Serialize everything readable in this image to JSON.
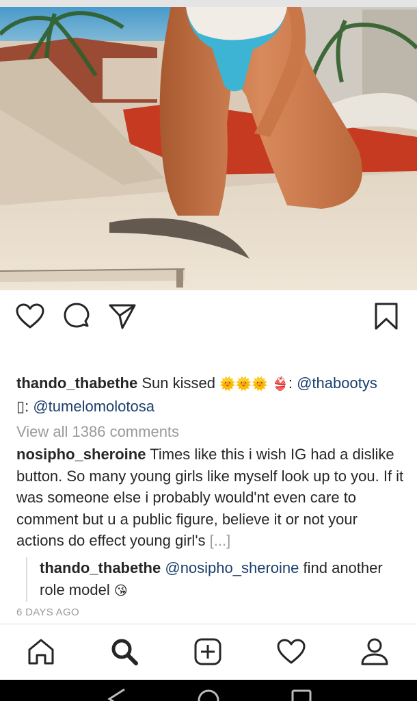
{
  "post": {
    "image_alt": "post photo",
    "actions": {
      "like_icon": "heart-outline-icon",
      "comment_icon": "comment-bubble-icon",
      "share_icon": "paper-plane-icon",
      "save_icon": "bookmark-icon"
    },
    "caption": {
      "username": "thando_thabethe",
      "text": " Sun kissed ",
      "sun_emojis": "🌞🌞🌞",
      "bikini_emoji": "👙",
      "separator": ": ",
      "mention_1": "@thabootys",
      "glyph": "▯",
      "separator_2": ": ",
      "mention_2": "@tumelomolotosa"
    },
    "view_all_comments": "View all 1386 comments",
    "comment": {
      "username": "nosipho_sheroine",
      "text": " Times like this i wish IG had a dislike button. So many young girls like myself look up to you. If it was someone else i probably would'nt even care to comment  but u a  public figure, believe it or not your actions do effect young girl's ",
      "more_label": "[...]"
    },
    "reply": {
      "username": "thando_thabethe",
      "mention": "@nosipho_sheroine",
      "text": " find another role model ",
      "emoji": "😘"
    },
    "timestamp": "6 DAYS AGO"
  },
  "bottom_nav": {
    "items": [
      {
        "icon": "home-icon"
      },
      {
        "icon": "search-icon"
      },
      {
        "icon": "add-post-icon"
      },
      {
        "icon": "activity-heart-icon"
      },
      {
        "icon": "profile-icon"
      }
    ]
  },
  "colors": {
    "text": "#262626",
    "mention": "#1b3f6e",
    "muted": "#999999",
    "divider": "#dbdbdb"
  }
}
